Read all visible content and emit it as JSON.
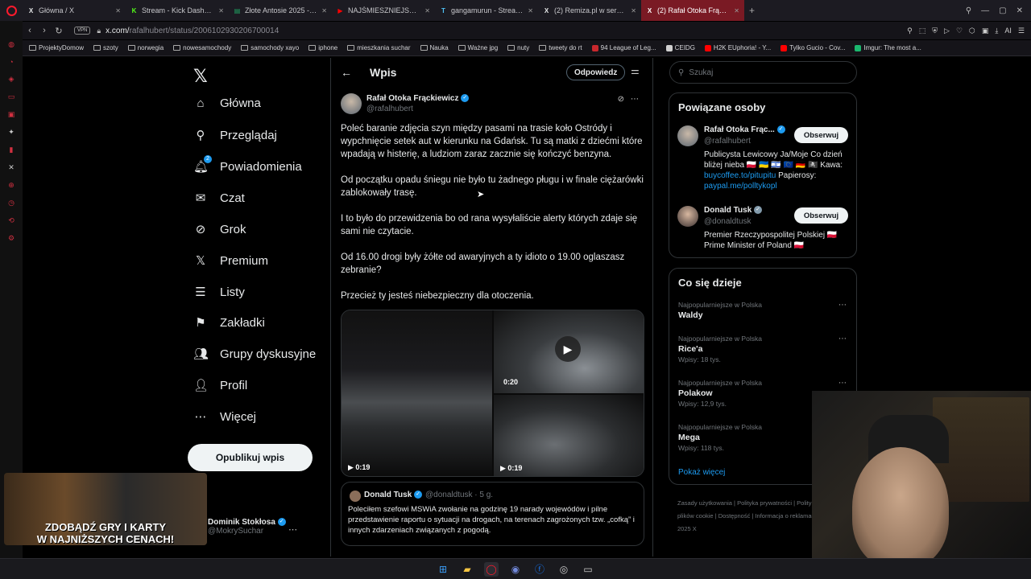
{
  "browser": {
    "tabs": [
      {
        "label": "Główna / X",
        "icon": "x-icon",
        "color": "#e7e9ea",
        "glyph": "X"
      },
      {
        "label": "Stream - Kick Dashboard",
        "icon": "kick-icon",
        "color": "#53fc18",
        "glyph": "K"
      },
      {
        "label": "Złote Antosie 2025 - Arku",
        "icon": "sheets-icon",
        "color": "#1fa463",
        "glyph": "▤"
      },
      {
        "label": "NAJŚMIESZNIEJSZE MOM",
        "icon": "youtube-icon",
        "color": "#ff0000",
        "glyph": "▶"
      },
      {
        "label": "gangamurun - Stream Jan",
        "icon": "text-icon",
        "color": "#4fc3f7",
        "glyph": "T"
      },
      {
        "label": "(2) Remiza.pl w serwisie X",
        "icon": "x-icon",
        "color": "#e7e9ea",
        "glyph": "X"
      },
      {
        "label": "(2) Rafał Otoka Frąckiewic",
        "icon": "x-icon",
        "color": "#ffffff",
        "glyph": "X",
        "active": true
      }
    ],
    "new_tab": "+",
    "url_host": "x.com/",
    "url_path": "rafalhubert/status/2006102930206700014",
    "vpn": "VPN",
    "ai_label": "AI",
    "bookmarks": [
      {
        "label": "ProjektyDomow",
        "type": "folder"
      },
      {
        "label": "szoty",
        "type": "folder"
      },
      {
        "label": "norwegia",
        "type": "folder"
      },
      {
        "label": "nowesamochody",
        "type": "folder"
      },
      {
        "label": "samochody xayo",
        "type": "folder"
      },
      {
        "label": "iphone",
        "type": "folder"
      },
      {
        "label": "mieszkania suchar",
        "type": "folder"
      },
      {
        "label": "Nauka",
        "type": "folder"
      },
      {
        "label": "Ważne jpg",
        "type": "folder"
      },
      {
        "label": "nuty",
        "type": "folder"
      },
      {
        "label": "tweety do rt",
        "type": "folder"
      },
      {
        "label": "94 League of Leg...",
        "type": "site",
        "color": "#c8282d"
      },
      {
        "label": "CEIDG",
        "type": "site",
        "color": "#d0d0d0"
      },
      {
        "label": "H2K EUphoria! - Y...",
        "type": "site",
        "color": "#ff0000"
      },
      {
        "label": "Tylko Gucio - Cov...",
        "type": "site",
        "color": "#ff0000"
      },
      {
        "label": "Imgur: The most a...",
        "type": "site",
        "color": "#1bb76e"
      }
    ]
  },
  "left_nav": {
    "items": [
      {
        "label": "Główna",
        "icon": "home-icon",
        "glyph": "⌂"
      },
      {
        "label": "Przeglądaj",
        "icon": "search-icon",
        "glyph": "⚲"
      },
      {
        "label": "Powiadomienia",
        "icon": "bell-icon",
        "glyph": "🔔︎",
        "badge": "2"
      },
      {
        "label": "Czat",
        "icon": "mail-icon",
        "glyph": "✉"
      },
      {
        "label": "Grok",
        "icon": "grok-icon",
        "glyph": "⊘"
      },
      {
        "label": "Premium",
        "icon": "x-icon",
        "glyph": "𝕏"
      },
      {
        "label": "Listy",
        "icon": "list-icon",
        "glyph": "☰"
      },
      {
        "label": "Zakładki",
        "icon": "bookmark-icon",
        "glyph": "⚑"
      },
      {
        "label": "Grupy dyskusyjne",
        "icon": "people-icon",
        "glyph": "👥︎"
      },
      {
        "label": "Profil",
        "icon": "person-icon",
        "glyph": "👤︎"
      },
      {
        "label": "Więcej",
        "icon": "more-icon",
        "glyph": "⋯"
      }
    ],
    "post_button": "Opublikuj wpis",
    "account": {
      "name": "Dominik Stokłosa",
      "handle": "@MokrySuchar"
    }
  },
  "main": {
    "title": "Wpis",
    "reply_button": "Odpowiedz",
    "author": {
      "name": "Rafał Otoka Frąckiewicz",
      "handle": "@rafalhubert"
    },
    "paragraphs": [
      "Poleć baranie zdjęcia szyn między pasami na trasie koło Ostródy  i wypchnięcie setek aut w kierunku na Gdańsk. Tu są matki z dziećmi które wpadają w histerię, a ludziom zaraz zacznie się kończyć benzyna.",
      "Od początku opadu śniegu nie było tu żadnego pługu i w finale ciężarówki zablokowały trasę.",
      "I to było do przewidzenia bo od rana wysyłaliście alerty których zdaje się sami nie czytacie.",
      "Od 16.00 drogi były żółte od awaryjnych a ty idioto o 19.00 oglaszasz zebranie?",
      "Przecież ty jesteś niebezpieczny dla otoczenia."
    ],
    "videos": [
      {
        "duration": "0:19"
      },
      {
        "duration": "0:20"
      },
      {
        "duration": "0:19"
      }
    ],
    "quote": {
      "name": "Donald Tusk",
      "handle": "@donaldtusk · 5 g.",
      "text": "Poleciłem szefowi MSWiA zwołanie na godzinę 19 narady wojewódów i pilne przedstawienie raportu o sytuacji na drogach, na terenach zagrożonych tzw. „cofką” i innych zdarzeniach związanych z pogodą."
    }
  },
  "right": {
    "search_placeholder": "Szukaj",
    "related_title": "Powiązane osoby",
    "people": [
      {
        "name": "Rafał Otoka Frąc...",
        "handle": "@rafalhubert",
        "button": "Obserwuj",
        "bio_text": "Publicysta Lewicowy Ja/Moje Co dzień bliżej nieba 🇵🇱 🇺🇦 🇮🇱 🇪🇺 🇩🇪 🏴‍☠️ Kawa:",
        "link1": "buycoffee.to/pitupitu",
        "bio_mid": " Papierosy:",
        "link2": "paypal.me/polltykopl"
      },
      {
        "name": "Donald Tusk",
        "handle": "@donaldtusk",
        "button": "Obserwuj",
        "bio_text": "Premier Rzeczypospolitej Polskiej 🇵🇱 Prime Minister of Poland 🇵🇱"
      }
    ],
    "trends_title": "Co się dzieje",
    "trends": [
      {
        "category": "Najpopularniejsze w Polska",
        "name": "Waldy",
        "count": ""
      },
      {
        "category": "Najpopularniejsze w Polska",
        "name": "Rice'a",
        "count": "Wpisy: 18 tys."
      },
      {
        "category": "Najpopularniejsze w Polska",
        "name": "Polakow",
        "count": "Wpisy: 12,9 tys."
      },
      {
        "category": "Najpopularniejsze w Polska",
        "name": "Mega",
        "count": "Wpisy: 118 tys."
      }
    ],
    "show_more": "Pokaż więcej",
    "footer": [
      "Zasady użytkowania",
      "Polityka prywatności",
      "Polityka dotycząca plików cookie",
      "Dostępność",
      "Informacja o reklamach",
      "Więcej ···",
      "© 2025 X"
    ]
  },
  "overlay": {
    "ad_text_line1": "ZDOBĄDŹ GRY I KARTY",
    "ad_text_line2": "W NAJNIŻSZYCH CENACH!"
  }
}
